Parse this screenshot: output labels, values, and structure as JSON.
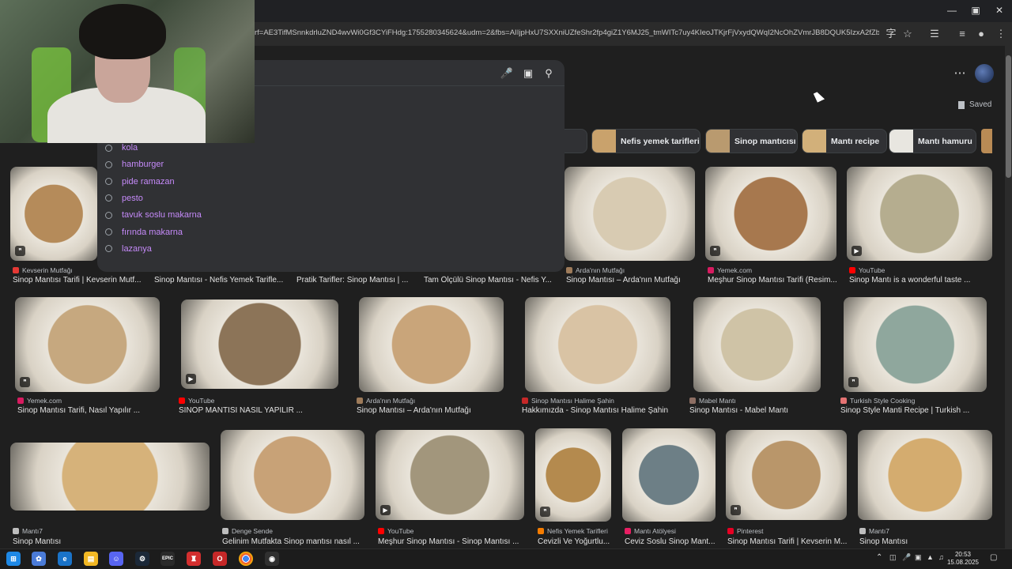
{
  "browser": {
    "url": "rf=AE3TifMSnnkdrluZND4wvWi0Gf3CYiFHdg:1755280345624&udm=2&fbs=AIIjpHxU7SXXniUZfeShr2fp4giZ1Y6MJ25_tmWITc7uy4KIeoJTKjrFjVxydQWqI2NcOhZVmrJB8DQUK5IzxA2fZbQFc9Q..."
  },
  "suggestions": [
    "kola",
    "hamburger",
    "pide ramazan",
    "pesto",
    "tavuk soslu makarna",
    "fırında makarna",
    "lazanya"
  ],
  "header": {
    "saved_label": "Saved"
  },
  "chips": [
    {
      "label": "antı",
      "color": "#8a6b4a"
    },
    {
      "label": "Nefis yemek tarifleri",
      "color": "#c9a26c"
    },
    {
      "label": "Sinop mantıcısı",
      "color": "#b99a6f"
    },
    {
      "label": "Mantı recipe",
      "color": "#d2b07a"
    },
    {
      "label": "Mantı hamuru",
      "color": "#e8e6e0"
    }
  ],
  "results": [
    {
      "source": "Kevserin Mutfağı",
      "title": "Sinop Mantısı Tarifi | Kevserin Mutf...",
      "fav": "#e53935",
      "color": "#b58b5a"
    },
    {
      "source": "",
      "title": "Sinop Mantısı - Nefis Yemek Tarifle...",
      "fav": "",
      "color": ""
    },
    {
      "source": "",
      "title": "Pratik Tarifler: Sinop Mantısı | ...",
      "fav": "",
      "color": ""
    },
    {
      "source": "",
      "title": "Tam Ölçülü Sinop Mantısı - Nefis Y...",
      "fav": "",
      "color": ""
    },
    {
      "source": "Arda'nın Mutfağı",
      "title": "Sinop Mantısı – Arda'nın Mutfağı",
      "fav": "#9e7b5a",
      "color": "#d8cbb2"
    },
    {
      "source": "Yemek.com",
      "title": "Meşhur Sinop Mantısı Tarifi (Resim...",
      "fav": "#d81b60",
      "color": "#a7784e"
    },
    {
      "source": "YouTube",
      "title": "Sinop Mantı is a wonderful taste ...",
      "fav": "#ff0000",
      "color": "#b5ad8f"
    },
    {
      "source": "Yemek.com",
      "title": "Sinop Mantısı Tarifi, Nasıl Yapılır ...",
      "fav": "#d81b60",
      "color": "#c6a87f"
    },
    {
      "source": "YouTube",
      "title": "SİNOP MANTISI NASIL YAPILIR ...",
      "fav": "#ff0000",
      "color": "#8c7458"
    },
    {
      "source": "Arda'nın Mutfağı",
      "title": "Sinop Mantısı – Arda'nın Mutfağı",
      "fav": "#9e7b5a",
      "color": "#c9a57a"
    },
    {
      "source": "Sinop Mantısı Halime Şahin",
      "title": "Hakkımızda - Sinop Mantısı Halime Şahin",
      "fav": "#c62828",
      "color": "#d9c3a4"
    },
    {
      "source": "Mabel Mantı",
      "title": "Sinop Mantısı - Mabel Mantı",
      "fav": "#8d6e63",
      "color": "#cfc3a6"
    },
    {
      "source": "Turkish Style Cooking",
      "title": "Sinop Style Manti Recipe | Turkish ...",
      "fav": "#e57373",
      "color": "#8fa79d"
    },
    {
      "source": "Mantı7",
      "title": "Sinop Mantısı",
      "fav": "#bdbdbd",
      "color": "#d6b27a"
    },
    {
      "source": "Denge Sende",
      "title": "Gelinim Mutfakta Sinop mantısı nasıl ...",
      "fav": "#bdbdbd",
      "color": "#c8a277"
    },
    {
      "source": "YouTube",
      "title": "Meşhur Sinop Mantısı - Sinop Mantısı ...",
      "fav": "#ff0000",
      "color": "#a2967c"
    },
    {
      "source": "Nefis Yemek Tarifleri",
      "title": "Cevizli Ve Yoğurtlu...",
      "fav": "#f57c00",
      "color": "#b48a4e"
    },
    {
      "source": "Mantı Atölyesi",
      "title": "Ceviz Soslu Sinop Mant...",
      "fav": "#e91e63",
      "color": "#6d7f86"
    },
    {
      "source": "Pinterest",
      "title": "Sinop Mantısı Tarifi | Kevserin M...",
      "fav": "#e60023",
      "color": "#b9966a"
    },
    {
      "source": "Mantı7",
      "title": "Sinop Mantısı",
      "fav": "#bdbdbd",
      "color": "#d4ac6f"
    }
  ],
  "taskbar": {
    "apps": [
      "windows",
      "copilot",
      "edge",
      "file-explorer",
      "discord",
      "steam",
      "epic-games",
      "app-red",
      "opera",
      "chrome",
      "obs"
    ],
    "epic_label": "EPIC",
    "time": "20:53",
    "date": "15.08.2025"
  }
}
